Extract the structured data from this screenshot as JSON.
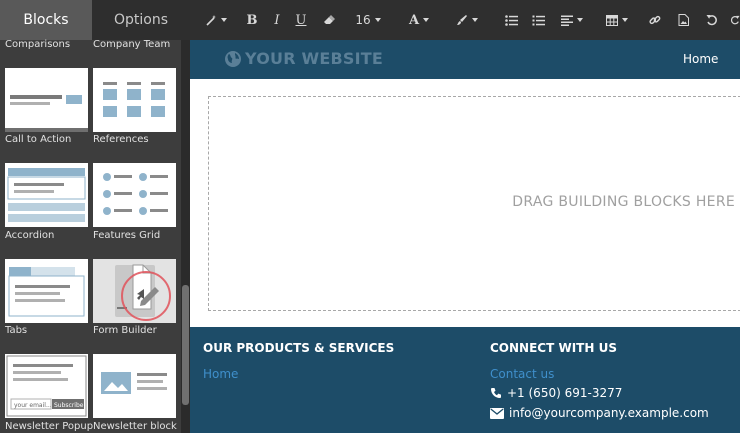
{
  "sidebar": {
    "tabs": [
      {
        "label": "Blocks",
        "active": true
      },
      {
        "label": "Options",
        "active": false
      }
    ],
    "blocks": [
      {
        "label": "Comparisons"
      },
      {
        "label": "Company Team"
      },
      {
        "label": "Call to Action"
      },
      {
        "label": "References"
      },
      {
        "label": "Accordion"
      },
      {
        "label": "Features Grid"
      },
      {
        "label": "Tabs"
      },
      {
        "label": "Form Builder"
      },
      {
        "label": "Newsletter Popup"
      },
      {
        "label": "Newsletter block"
      }
    ],
    "newsletter_popup": {
      "email_placeholder": "your email...",
      "subscribe_label": "Subscribe"
    }
  },
  "toolbar": {
    "font_size": "16",
    "font_color_letter": "A",
    "icons": [
      "magic-wand-icon",
      "bold-icon",
      "italic-icon",
      "underline-icon",
      "eraser-icon",
      "font-color-icon",
      "brush-icon",
      "bullet-list-icon",
      "numbered-list-icon",
      "align-icon",
      "table-icon",
      "link-icon",
      "image-icon",
      "undo-icon",
      "redo-icon"
    ]
  },
  "editor": {
    "site_title": "YOUR WEBSITE",
    "nav": {
      "home": "Home"
    },
    "dropzone_text": "DRAG BUILDING BLOCKS HERE",
    "footer": {
      "products_title": "OUR PRODUCTS & SERVICES",
      "products_link": "Home",
      "connect_title": "CONNECT WITH US",
      "contact_link": "Contact us",
      "phone": "+1 (650) 691-3277",
      "email": "info@yourcompany.example.com"
    }
  },
  "colors": {
    "header_bg": "#1d4c68",
    "sidebar_bg": "#3d3d3d",
    "toolbar_bg": "#2f2f2f",
    "link": "#3f8fcb",
    "thumb_accent": "#8fb3cb",
    "cursor_ring": "#e0525a"
  }
}
